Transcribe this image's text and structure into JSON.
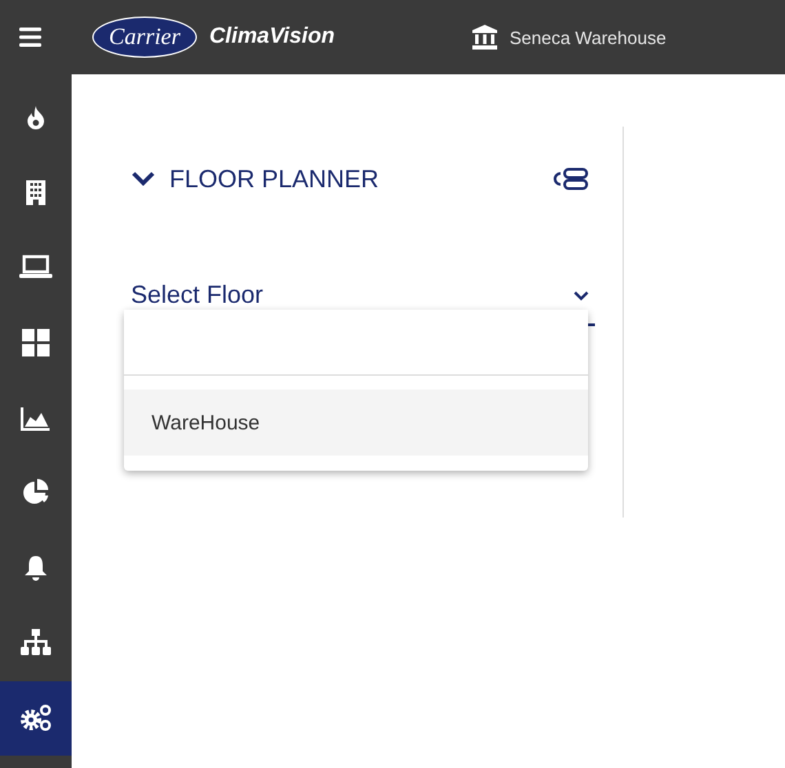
{
  "topbar": {
    "logo": {
      "brand": "Carrier",
      "product": "ClimaVision"
    },
    "site": "Seneca Warehouse"
  },
  "sidebar": {
    "items": [
      {
        "kind": "flame",
        "selected": false
      },
      {
        "kind": "building",
        "selected": false
      },
      {
        "kind": "laptop",
        "selected": false
      },
      {
        "kind": "grid",
        "selected": false
      },
      {
        "kind": "area-chart",
        "selected": false
      },
      {
        "kind": "pie",
        "selected": false
      },
      {
        "kind": "bell",
        "selected": false
      },
      {
        "kind": "hierarchy",
        "selected": false
      },
      {
        "kind": "gears",
        "selected": true
      }
    ]
  },
  "panel": {
    "title": "FLOOR PLANNER",
    "expanded": true,
    "select": {
      "placeholder": "Select Floor",
      "open": true,
      "options": [
        {
          "label": "WareHouse",
          "selected": true
        }
      ]
    }
  }
}
